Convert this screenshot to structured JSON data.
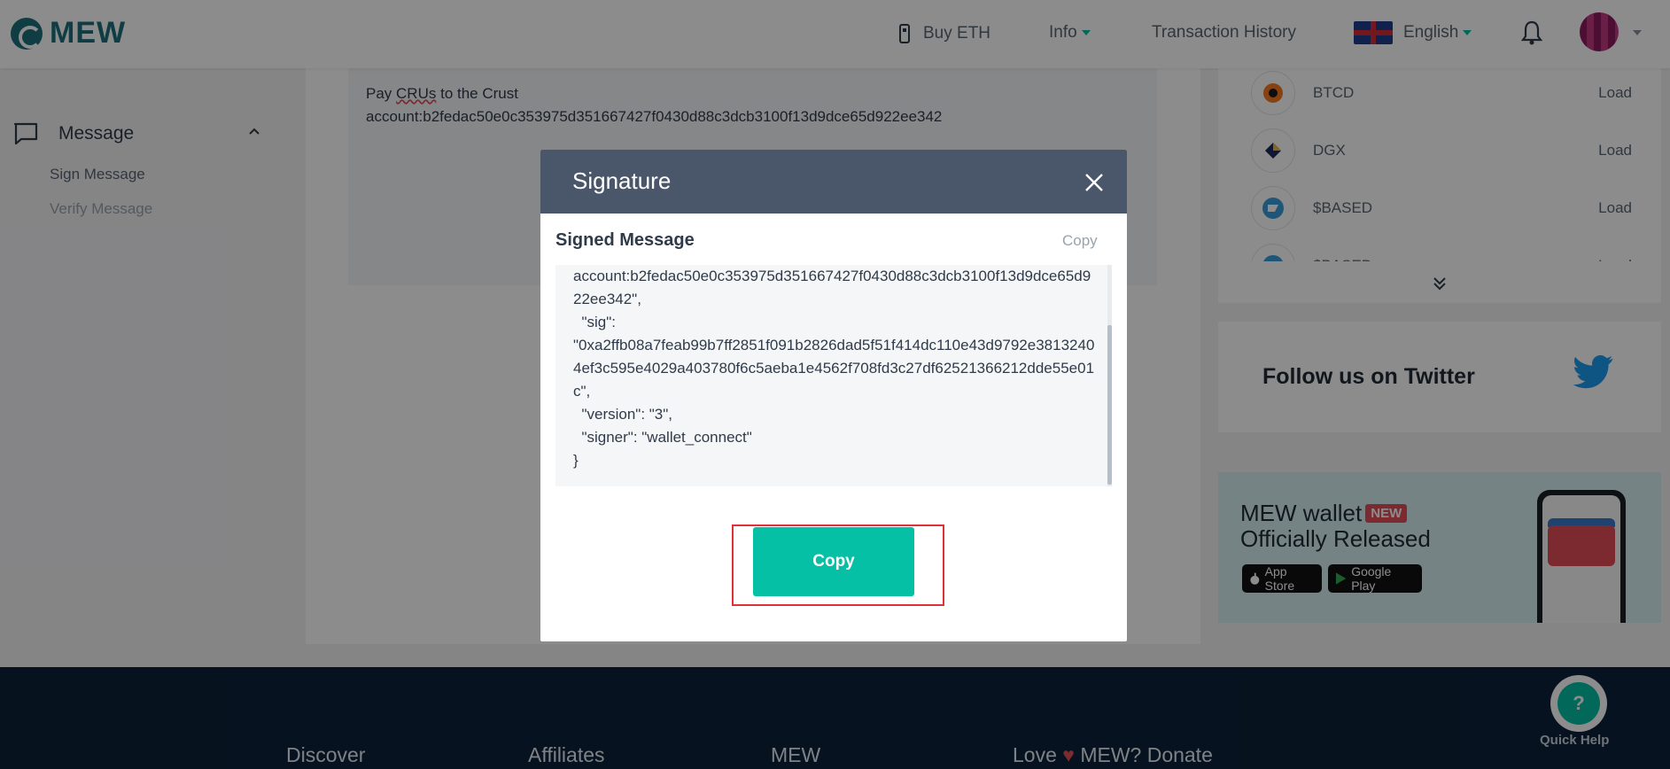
{
  "header": {
    "logo_text": "MEW",
    "nav": {
      "buy_eth": "Buy ETH",
      "info": "Info",
      "transaction_history": "Transaction History",
      "language": "English"
    }
  },
  "sidebar": {
    "section_title": "Message",
    "items": [
      {
        "label": "Sign Message"
      },
      {
        "label": "Verify Message"
      }
    ]
  },
  "message_box": {
    "line1_prefix": "Pay ",
    "line1_underlined": "CRUs",
    "line1_suffix": " to the Crust",
    "line2": "account:b2fedac50e0c353975d351667427f0430d88c3dcb3100f13d9dce65d922ee342"
  },
  "tokens": [
    {
      "name": "BTCD",
      "action": "Load"
    },
    {
      "name": "DGX",
      "action": "Load"
    },
    {
      "name": "$BASED",
      "action": "Load"
    },
    {
      "name": "$BASED",
      "action": "Load"
    }
  ],
  "twitter": {
    "label": "Follow us on Twitter"
  },
  "banner": {
    "title_line1": "MEW wallet",
    "badge": "NEW",
    "title_line2": "Officially Released",
    "app_store": "App Store",
    "google_play": "Google Play"
  },
  "footer": {
    "items": [
      "Discover",
      "Affiliates",
      "MEW",
      "Love",
      "MEW? Donate"
    ],
    "quick_help": "Quick Help"
  },
  "modal": {
    "title": "Signature",
    "signed_message_label": "Signed Message",
    "copy_link": "Copy",
    "signature_text": "account:b2fedac50e0c353975d351667427f0430d88c3dcb3100f13d9dce65d922ee342\",\n  \"sig\":\n\"0xa2ffb08a7feab99b7ff2851f091b2826dad5f51f414dc110e43d9792e38132404ef3c595e4029a403780f6c5aeba1e4562f708fd3c27df62521366212dde55e01c\",\n  \"version\": \"3\",\n  \"signer\": \"wallet_connect\"\n}",
    "copy_button": "Copy"
  },
  "colors": {
    "accent": "#05c0a5",
    "modal_header": "#4a566a",
    "footer_bg": "#0b2239",
    "highlight": "#e0303a"
  }
}
